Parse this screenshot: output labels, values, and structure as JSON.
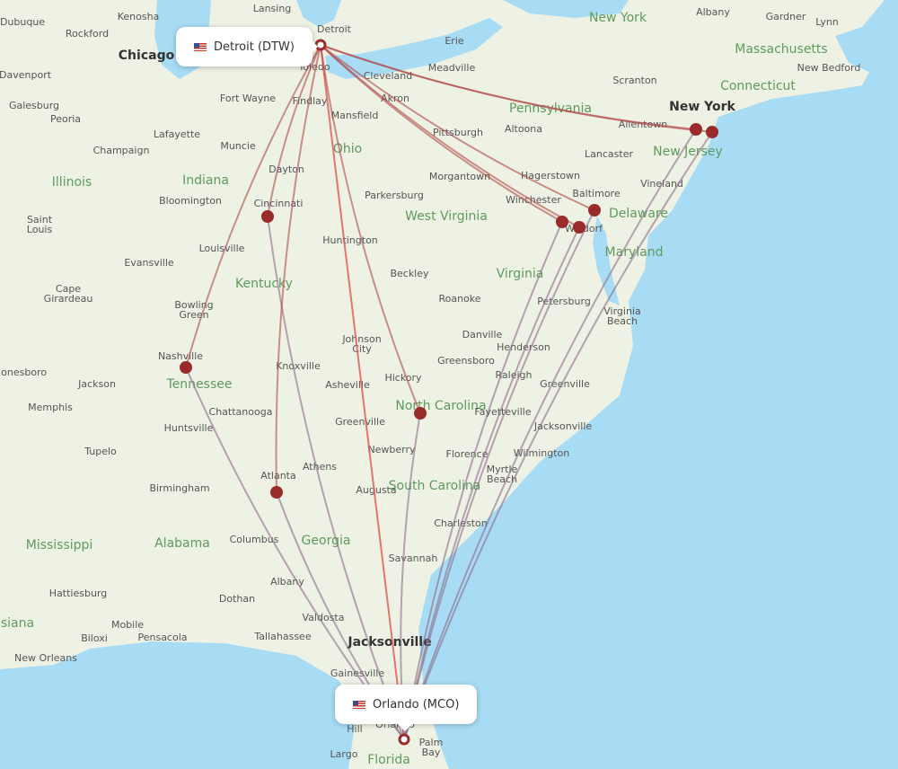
{
  "origin": {
    "label": "Detroit (DTW)",
    "flag_icon": "us-flag-icon"
  },
  "destination": {
    "label": "Orlando (MCO)",
    "flag_icon": "us-flag-icon"
  },
  "colors": {
    "land": "#eef2e4",
    "water": "#a8dcf4",
    "route": "#b04a4a",
    "route_alt": "#8a6a8a",
    "marker": "#9b2b2b",
    "state_label": "#5e9a5e"
  },
  "states": [
    "Illinois",
    "Indiana",
    "Ohio",
    "West Virginia",
    "Pennsylvania",
    "Kentucky",
    "Virginia",
    "Tennessee",
    "North Carolina",
    "South Carolina",
    "Georgia",
    "Alabama",
    "Mississippi",
    "Florida",
    "Maryland",
    "Delaware",
    "New Jersey",
    "Massachusetts",
    "Connecticut",
    "New York",
    "Louisiana"
  ],
  "major_cities": [
    "Chicago",
    "Jacksonville",
    "New York"
  ],
  "cities": [
    "Kenosha",
    "Lansing",
    "Detroit",
    "Dubuque",
    "Rockford",
    "Davenport",
    "Galesburg",
    "Peoria",
    "Fort Wayne",
    "Findlay",
    "Toledo",
    "Cleveland",
    "Erie",
    "Meadville",
    "Akron",
    "Mansfield",
    "Lafayette",
    "Muncie",
    "Champaign",
    "Dayton",
    "Pittsburgh",
    "Altoona",
    "Scranton",
    "Allentown",
    "Lancaster",
    "Hagerstown",
    "Morgantown",
    "Baltimore",
    "Vineland",
    "Winchester",
    "Waldorf",
    "Cincinnati",
    "Bloomington",
    "Parkersburg",
    "Saint",
    "Louis",
    "Louisville",
    "Huntington",
    "Evansville",
    "Beckley",
    "Roanoke",
    "Petersburg",
    "Cape",
    "Girardeau",
    "Bowling",
    "Green",
    "Virginia",
    "Beach",
    "Danville",
    "Johnson",
    "City",
    "Henderson",
    "Jonesboro",
    "Jackson",
    "Nashville",
    "Knoxville",
    "Greensboro",
    "Raleigh",
    "Hickory",
    "Asheville",
    "Greenville",
    "Memphis",
    "Chattanooga",
    "Greenville",
    "Fayetteville",
    "Jacksonville",
    "Huntsville",
    "Newberry",
    "Florence",
    "Wilmington",
    "Tupelo",
    "Myrtle",
    "Beach",
    "Atlanta",
    "Athens",
    "Augusta",
    "Birmingham",
    "Charleston",
    "Columbus",
    "Savannah",
    "Albany",
    "Hattiesburg",
    "Dothan",
    "Valdosta",
    "Mobile",
    "Biloxi",
    "Pensacola",
    "Tallahassee",
    "New Orleans",
    "Gainesville",
    "Hill",
    "Palm",
    "Bay",
    "Largo",
    "Orlando",
    "Albany",
    "Gardner",
    "Lynn",
    "New Bedford"
  ]
}
